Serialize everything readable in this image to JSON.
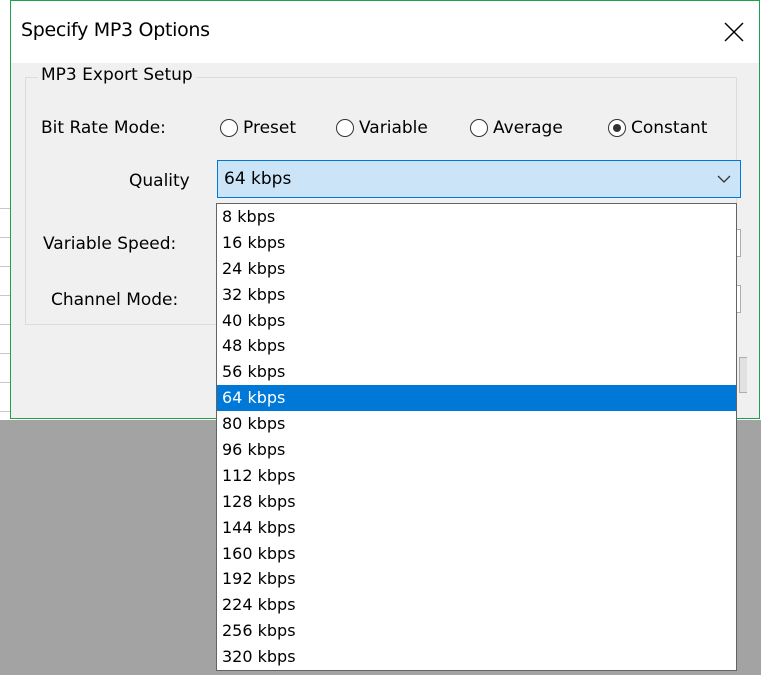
{
  "dialog": {
    "title": "Specify MP3 Options"
  },
  "group": {
    "legend": "MP3 Export Setup"
  },
  "bit_rate_mode": {
    "label": "Bit Rate Mode:",
    "options": [
      {
        "label": "Preset",
        "selected": false
      },
      {
        "label": "Variable",
        "selected": false
      },
      {
        "label": "Average",
        "selected": false
      },
      {
        "label": "Constant",
        "selected": true
      }
    ]
  },
  "quality": {
    "label": "Quality",
    "value": "64 kbps",
    "options": [
      "8 kbps",
      "16 kbps",
      "24 kbps",
      "32 kbps",
      "40 kbps",
      "48 kbps",
      "56 kbps",
      "64 kbps",
      "80 kbps",
      "96 kbps",
      "112 kbps",
      "128 kbps",
      "144 kbps",
      "160 kbps",
      "192 kbps",
      "224 kbps",
      "256 kbps",
      "320 kbps"
    ],
    "highlighted": "64 kbps"
  },
  "variable_speed": {
    "label": "Variable Speed:"
  },
  "channel_mode": {
    "label": "Channel Mode:"
  },
  "icons": {
    "close": "close-icon",
    "dropdown": "chevron-down-icon"
  },
  "colors": {
    "accent": "#0078d7",
    "combo_bg": "#cce4f7",
    "dialog_border": "#1aa34a"
  }
}
